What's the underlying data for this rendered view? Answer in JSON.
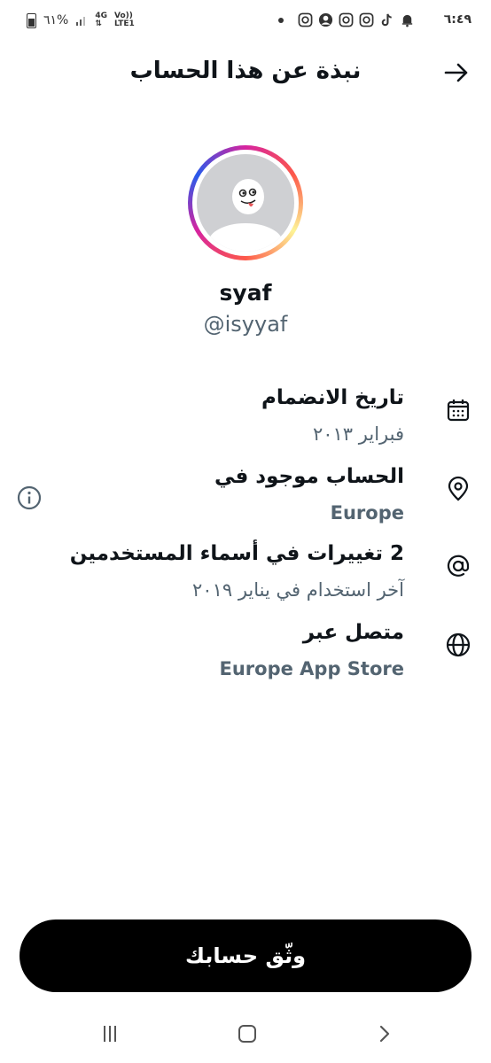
{
  "status_bar": {
    "time": "٦:٤٩",
    "battery": "٦١%",
    "network_type": "4G",
    "volte": "Vo))",
    "lte": "LTE1"
  },
  "header": {
    "title": "نبذة عن هذا الحساب"
  },
  "profile": {
    "display_name": "syaf",
    "handle": "@isyyaf"
  },
  "info": {
    "joined": {
      "title": "تاريخ الانضمام",
      "value": "فبراير ٢٠١٣"
    },
    "location": {
      "title": "الحساب موجود في",
      "value": "Europe"
    },
    "username_changes": {
      "title": "2 تغييرات في أسماء المستخدمين",
      "value": "آخر استخدام في يناير ٢٠١٩"
    },
    "connected_via": {
      "title": "متصل عبر",
      "value": "Europe App Store"
    }
  },
  "verify_button": {
    "label": "وثّق حسابك"
  },
  "colors": {
    "primary_text": "#0f1419",
    "secondary_text": "#536471",
    "button_bg": "#000000"
  }
}
